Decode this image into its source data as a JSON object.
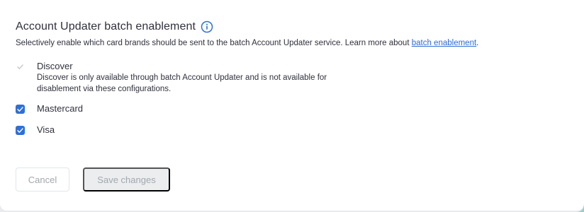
{
  "section": {
    "title": "Account Updater batch enablement",
    "description_prefix": "Selectively enable which card brands should be sent to the batch Account Updater service. Learn more about ",
    "description_link": "batch enablement",
    "description_suffix": "."
  },
  "options": [
    {
      "label": "Discover",
      "description_line1": "Discover is only available through batch Account Updater and is not available for",
      "description_line2": "disablement via these configurations.",
      "checked": true,
      "disabled": true
    },
    {
      "label": "Mastercard",
      "checked": true,
      "disabled": false
    },
    {
      "label": "Visa",
      "checked": true,
      "disabled": false
    }
  ],
  "actions": {
    "cancel_label": "Cancel",
    "save_label": "Save changes"
  },
  "colors": {
    "accent": "#2f6fd8",
    "link": "#2f6bd6",
    "text": "#30313d",
    "disabled_text": "#a3a7ae"
  }
}
